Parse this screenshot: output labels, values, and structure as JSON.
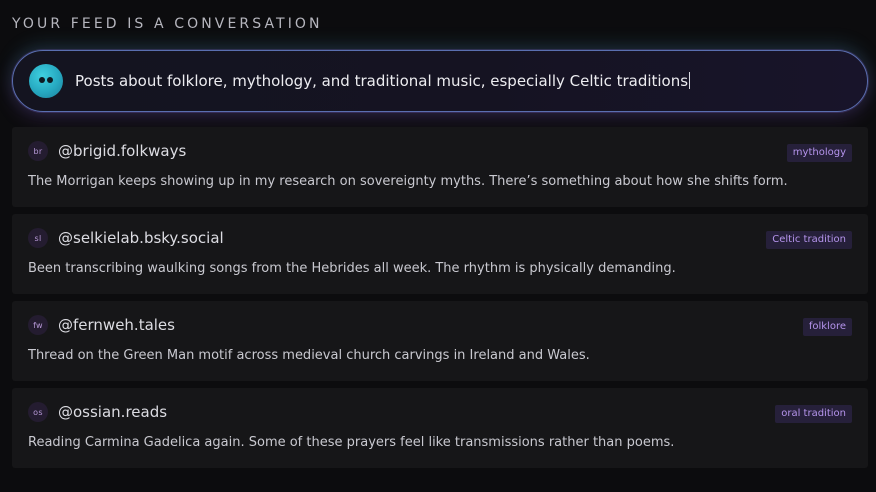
{
  "heading": "YOUR FEED IS A CONVERSATION",
  "prompt": {
    "avatar_icon": "bot-face-icon",
    "text": "Posts about folklore, mythology, and traditional music, especially Celtic traditions"
  },
  "colors": {
    "background": "#0c0c0e",
    "card": "#161618",
    "tag_bg": "#26203a",
    "tag_text": "#b594ec",
    "prompt_border": "#5a6fb0",
    "avatar_teal": "#2fb8cc"
  },
  "posts": [
    {
      "avatar": "br",
      "handle": "@brigid.folkways",
      "tag": "mythology",
      "text": "The Morrigan keeps showing up in my research on sovereignty myths. There’s something about how she shifts form."
    },
    {
      "avatar": "sl",
      "handle": "@selkielab.bsky.social",
      "tag": "Celtic tradition",
      "text": "Been transcribing waulking songs from the Hebrides all week. The rhythm is physically demanding."
    },
    {
      "avatar": "fw",
      "handle": "@fernweh.tales",
      "tag": "folklore",
      "text": "Thread on the Green Man motif across medieval church carvings in Ireland and Wales."
    },
    {
      "avatar": "os",
      "handle": "@ossian.reads",
      "tag": "oral tradition",
      "text": "Reading Carmina Gadelica again. Some of these prayers feel like transmissions rather than poems."
    }
  ]
}
